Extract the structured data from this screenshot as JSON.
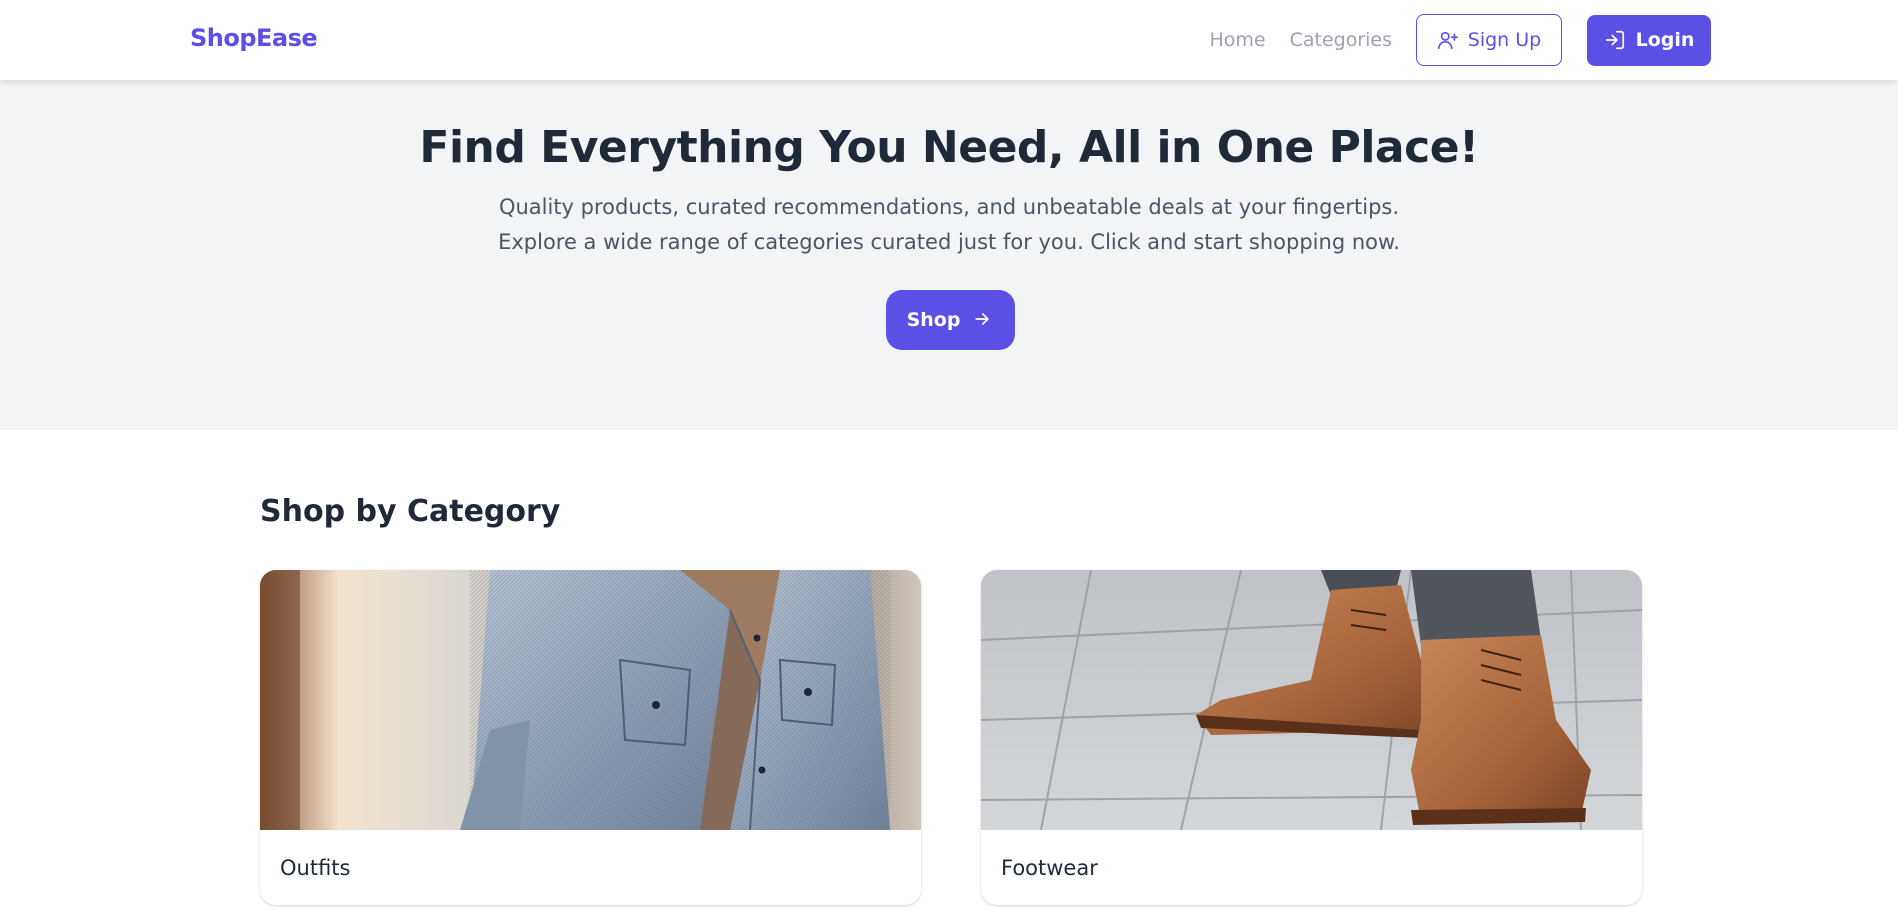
{
  "navbar": {
    "brand": "ShopEase",
    "links": [
      "Home",
      "Categories"
    ],
    "signup_label": "Sign Up",
    "login_label": "Login",
    "icons": {
      "signup": "user-plus-icon",
      "login": "login-arrow-icon"
    }
  },
  "hero": {
    "title": "Find Everything You Need, All in One Place!",
    "subtitle": "Quality products, curated recommendations, and unbeatable deals at your fingertips. Explore a wide range of categories curated just for you. Click and start shopping now.",
    "cta_label": "Shop",
    "cta_icon": "arrow-right-icon"
  },
  "categories": {
    "title": "Shop by Category",
    "items": [
      {
        "label": "Outfits"
      },
      {
        "label": "Footwear"
      }
    ]
  },
  "colors": {
    "accent": "#5b4fe6",
    "hero_background": "#f3f4f6",
    "nav_link": "#9ca3af",
    "heading": "#1f2937",
    "body_text": "#4b5563"
  }
}
